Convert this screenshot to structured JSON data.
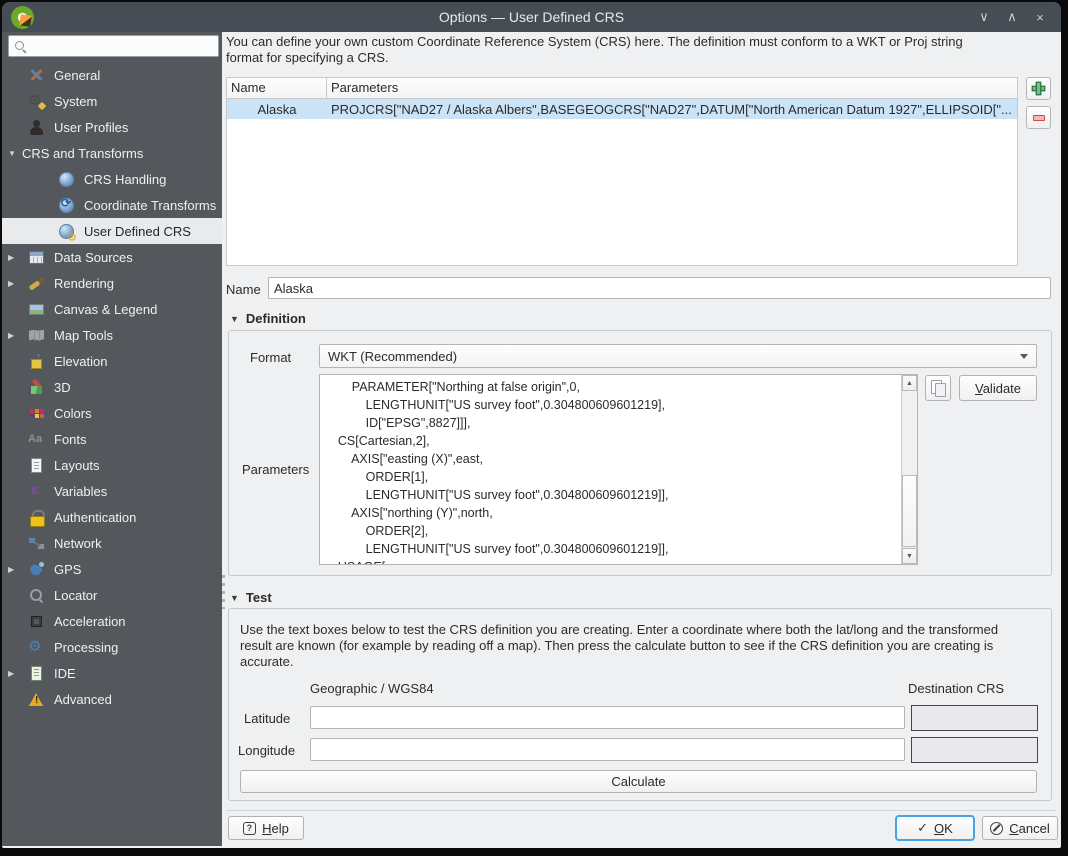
{
  "window": {
    "title": "Options — User Defined CRS",
    "controls": [
      {
        "icon": "shade-chevron-down-icon",
        "glyph": "∨"
      },
      {
        "icon": "maximize-chevron-up-icon",
        "glyph": "∧"
      },
      {
        "icon": "close-icon",
        "glyph": "×"
      }
    ],
    "app_logo": "qgis-logo"
  },
  "sidebar": {
    "search": {
      "placeholder": "",
      "value": "",
      "icon": "search-magnifier-icon"
    },
    "items": [
      {
        "label": "General",
        "icon": "general-tools-icon",
        "level": 0,
        "arrow": "none",
        "selected": false
      },
      {
        "label": "System",
        "icon": "system-gear-icon",
        "level": 0,
        "arrow": "none",
        "selected": false
      },
      {
        "label": "User Profiles",
        "icon": "user-profiles-icon",
        "level": 0,
        "arrow": "none",
        "selected": false
      },
      {
        "label": "CRS and Transforms",
        "icon": null,
        "level": 0,
        "arrow": "expanded",
        "selected": false
      },
      {
        "label": "CRS Handling",
        "icon": "crs-globe-icon",
        "level": 1,
        "arrow": "none",
        "selected": false
      },
      {
        "label": "Coordinate Transforms",
        "icon": "coordinate-transforms-icon",
        "level": 1,
        "arrow": "none",
        "selected": false
      },
      {
        "label": "User Defined CRS",
        "icon": "user-defined-crs-icon",
        "level": 1,
        "arrow": "none",
        "selected": true
      },
      {
        "label": "Data Sources",
        "icon": "data-sources-icon",
        "level": 0,
        "arrow": "collapsed",
        "selected": false
      },
      {
        "label": "Rendering",
        "icon": "rendering-brush-icon",
        "level": 0,
        "arrow": "collapsed",
        "selected": false
      },
      {
        "label": "Canvas & Legend",
        "icon": "canvas-legend-icon",
        "level": 0,
        "arrow": "none",
        "selected": false
      },
      {
        "label": "Map Tools",
        "icon": "map-tools-icon",
        "level": 0,
        "arrow": "collapsed",
        "selected": false
      },
      {
        "label": "Elevation",
        "icon": "elevation-icon",
        "level": 0,
        "arrow": "none",
        "selected": false
      },
      {
        "label": "3D",
        "icon": "cube-3d-icon",
        "level": 0,
        "arrow": "none",
        "selected": false
      },
      {
        "label": "Colors",
        "icon": "colors-swatch-icon",
        "level": 0,
        "arrow": "none",
        "selected": false
      },
      {
        "label": "Fonts",
        "icon": "fonts-icon",
        "level": 0,
        "arrow": "none",
        "selected": false
      },
      {
        "label": "Layouts",
        "icon": "layouts-page-icon",
        "level": 0,
        "arrow": "none",
        "selected": false
      },
      {
        "label": "Variables",
        "icon": "variables-epsilon-icon",
        "level": 0,
        "arrow": "none",
        "selected": false
      },
      {
        "label": "Authentication",
        "icon": "authentication-lock-icon",
        "level": 0,
        "arrow": "none",
        "selected": false
      },
      {
        "label": "Network",
        "icon": "network-icon",
        "level": 0,
        "arrow": "none",
        "selected": false
      },
      {
        "label": "GPS",
        "icon": "gps-icon",
        "level": 0,
        "arrow": "collapsed",
        "selected": false
      },
      {
        "label": "Locator",
        "icon": "locator-magnifier-icon",
        "level": 0,
        "arrow": "none",
        "selected": false
      },
      {
        "label": "Acceleration",
        "icon": "acceleration-chip-icon",
        "level": 0,
        "arrow": "none",
        "selected": false
      },
      {
        "label": "Processing",
        "icon": "processing-gear-icon",
        "level": 0,
        "arrow": "none",
        "selected": false
      },
      {
        "label": "IDE",
        "icon": "ide-script-icon",
        "level": 0,
        "arrow": "collapsed",
        "selected": false
      },
      {
        "label": "Advanced",
        "icon": "advanced-warning-icon",
        "level": 0,
        "arrow": "none",
        "selected": false
      }
    ]
  },
  "main": {
    "intro": "You can define your own custom Coordinate Reference System (CRS) here. The definition must conform to a WKT or Proj string format for specifying a CRS.",
    "crs_table": {
      "columns": [
        "Name",
        "Parameters"
      ],
      "rows": [
        {
          "name": "Alaska",
          "parameters": "PROJCRS[\"NAD27 / Alaska Albers\",BASEGEOGCRS[\"NAD27\",DATUM[\"North American Datum 1927\",ELLIPSOID[\"..."
        }
      ],
      "selected_row_index": 0
    },
    "toolbar": {
      "add_icon": "add-crs-plus-icon",
      "remove_icon": "remove-crs-minus-icon"
    },
    "name_field": {
      "label": "Name",
      "value": "Alaska"
    },
    "definition": {
      "title": "Definition",
      "collapse_icon": "triangle-down-icon",
      "format_label": "Format",
      "format_value": "WKT (Recommended)",
      "parameters_label": "Parameters",
      "copy_icon": "copy-icon",
      "validate_label": "Validate",
      "wkt_text": "        PARAMETER[\"Northing at false origin\",0,\n            LENGTHUNIT[\"US survey foot\",0.304800609601219],\n            ID[\"EPSG\",8827]]],\n    CS[Cartesian,2],\n        AXIS[\"easting (X)\",east,\n            ORDER[1],\n            LENGTHUNIT[\"US survey foot\",0.304800609601219]],\n        AXIS[\"northing (Y)\",north,\n            ORDER[2],\n            LENGTHUNIT[\"US survey foot\",0.304800609601219]],\n    USAGE["
    },
    "test": {
      "title": "Test",
      "collapse_icon": "triangle-down-icon",
      "description": "Use the text boxes below to test the CRS definition you are creating. Enter a coordinate where both the lat/long and the transformed result are known (for example by reading off a map). Then press the calculate button to see if the CRS definition you are creating is accurate.",
      "source_header": "Geographic / WGS84",
      "dest_header": "Destination CRS",
      "latitude_label": "Latitude",
      "latitude_value": "",
      "longitude_label": "Longitude",
      "longitude_value": "",
      "latitude_result": "",
      "longitude_result": "",
      "calculate_label": "Calculate"
    },
    "footer": {
      "help_label": "Help",
      "ok_label": "OK",
      "cancel_label": "Cancel"
    }
  },
  "colors": {
    "titlebar": "#474d54",
    "sidebar": "#54585d",
    "sidebar_selected": "#e9eaeb",
    "panel": "#eff0f1",
    "row_selected": "#cbe3f6",
    "ok_focus_border": "#48a2e8",
    "add_green": "#2f7d45",
    "remove_red": "#d24a4a"
  }
}
